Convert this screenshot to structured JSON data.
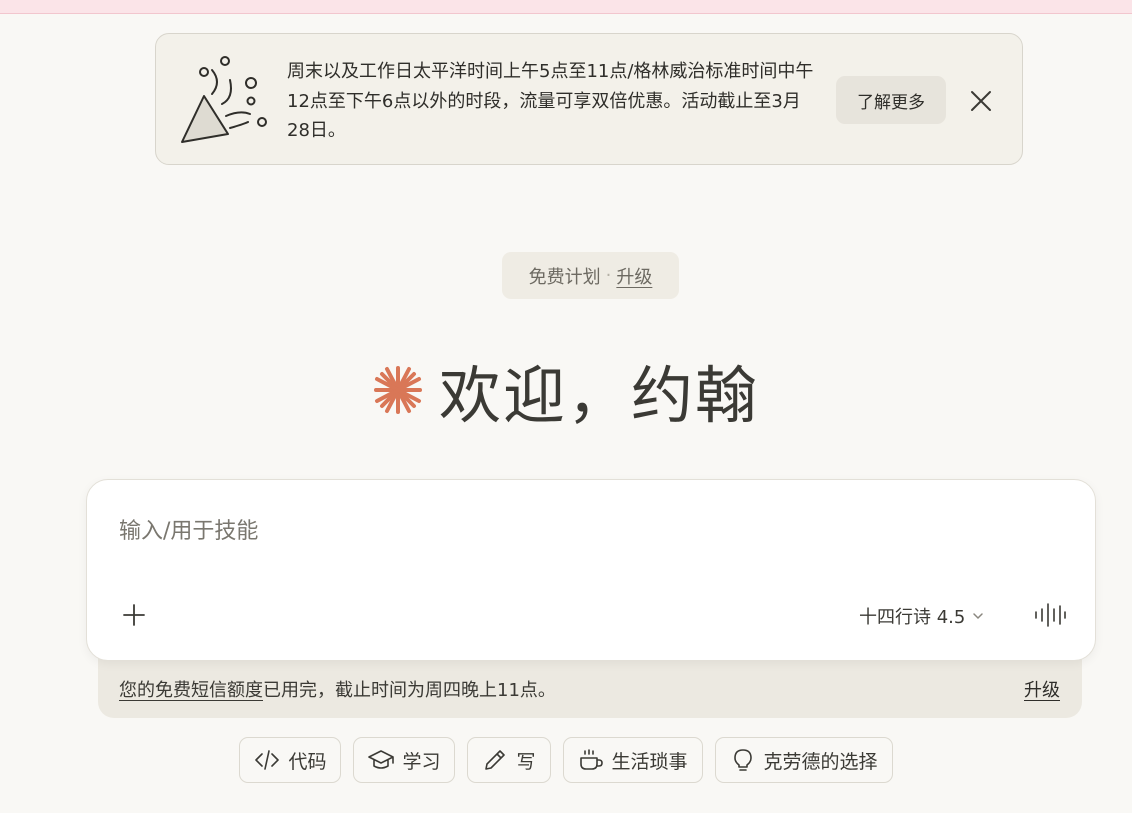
{
  "banner": {
    "message": "周末以及工作日太平洋时间上午5点至11点/格林威治标准时间中午12点至下午6点以外的时段，流量可享双倍优惠。活动截止至3月28日。",
    "learn_more": "了解更多"
  },
  "plan": {
    "label": "免费计划",
    "separator": "·",
    "upgrade": "升级"
  },
  "welcome": {
    "greeting": "欢迎，约翰"
  },
  "composer": {
    "placeholder": "输入/用于技能",
    "model": "十四行诗 4.5"
  },
  "notice": {
    "link_text": "您的免费短信额度",
    "message": "已用完，截止时间为周四晚上11点。",
    "upgrade": "升级"
  },
  "chips": [
    {
      "label": "代码",
      "icon": "code-icon"
    },
    {
      "label": "学习",
      "icon": "graduation-cap-icon"
    },
    {
      "label": "写",
      "icon": "pencil-icon"
    },
    {
      "label": "生活琐事",
      "icon": "coffee-cup-icon"
    },
    {
      "label": "克劳德的选择",
      "icon": "lightbulb-icon"
    }
  ],
  "colors": {
    "accent": "#d97757",
    "background": "#f9f8f5",
    "banner_bg": "#f3f1ea"
  }
}
